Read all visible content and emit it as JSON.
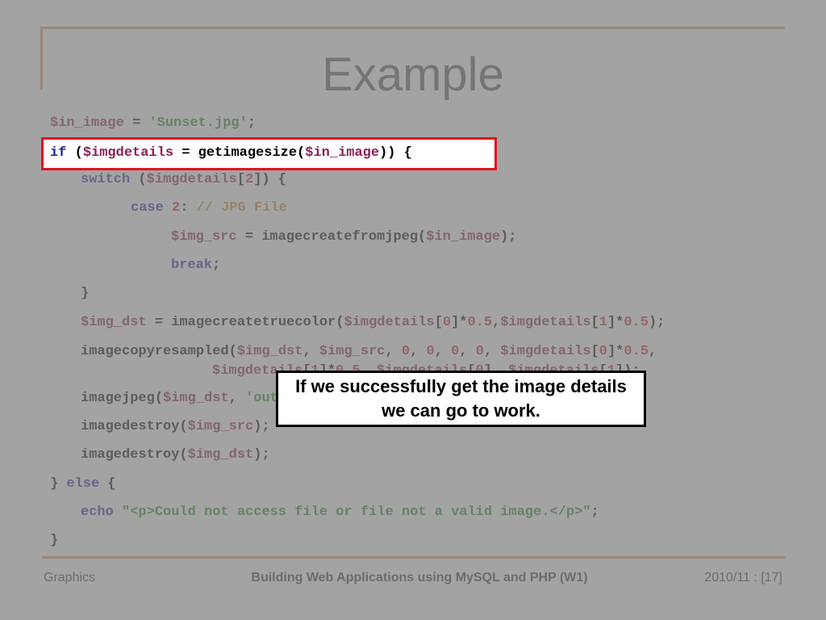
{
  "slide": {
    "title": "Example",
    "callout_text": "If we successfully get the image details we can go to work."
  },
  "code": {
    "l1": {
      "v1": "$in_image",
      "op": " = ",
      "s1": "'Sunset.jpg'",
      "end": ";"
    },
    "l2": {
      "k1": "if",
      "p1": " (",
      "v1": "$imgdetails",
      "p2": " = getimagesize(",
      "v2": "$in_image",
      "p3": ")) {"
    },
    "l3": {
      "k1": "switch",
      "p1": " (",
      "v1": "$imgdetails",
      "p2": "[",
      "n1": "2",
      "p3": "]) {"
    },
    "l4": {
      "k1": "case",
      "p1": " ",
      "n1": "2",
      "p2": ": ",
      "c1": "// JPG File"
    },
    "l5": {
      "v1": "$img_src",
      "p1": " = imagecreatefromjpeg(",
      "v2": "$in_image",
      "p2": ");"
    },
    "l6": {
      "k1": "break",
      "p1": ";"
    },
    "l7": {
      "p1": "}"
    },
    "l8": {
      "v1": "$img_dst",
      "p1": " = imagecreatetruecolor(",
      "v2": "$imgdetails",
      "p2": "[",
      "n1": "0",
      "p3": "]*",
      "n2": "0.5",
      "p4": ",",
      "v3": "$imgdetails",
      "p5": "[",
      "n3": "1",
      "p6": "]*",
      "n4": "0.5",
      "p7": ");"
    },
    "l9": {
      "p1": "imagecopyresampled(",
      "v1": "$img_dst",
      "p2": ", ",
      "v2": "$img_src",
      "p3": ", ",
      "n1": "0",
      "p4": ", ",
      "n2": "0",
      "p5": ", ",
      "n3": "0",
      "p6": ", ",
      "n4": "0",
      "p7": ", ",
      "v3": "$imgdetails",
      "p8": "[",
      "n5": "0",
      "p9": "]*",
      "n6": "0.5",
      "p10": ","
    },
    "l10": {
      "v1": "$imgdetails",
      "p1": "[",
      "n1": "1",
      "p2": "]*",
      "n2": "0.5",
      "p3": ", ",
      "v2": "$imgdetails",
      "p4": "[",
      "n3": "0",
      "p5": "], ",
      "v3": "$imgdetails",
      "p6": "[",
      "n4": "1",
      "p7": "]);"
    },
    "l11": {
      "p1": "imagejpeg(",
      "v1": "$img_dst",
      "p2": ", ",
      "s1": "'output.jpg"
    },
    "l12": {
      "p1": "imagedestroy(",
      "v1": "$img_src",
      "p2": ");"
    },
    "l13": {
      "p1": "imagedestroy(",
      "v1": "$img_dst",
      "p2": ");"
    },
    "l14": {
      "p1": "} ",
      "k1": "else",
      "p2": " {"
    },
    "l15": {
      "k1": "echo",
      "p1": " ",
      "s1": "\"<p>Could not access file or file not a valid image.</p>\"",
      "p2": ";"
    },
    "l16": {
      "p1": "}"
    }
  },
  "footer": {
    "left": "Graphics",
    "center": "Building Web Applications using MySQL and PHP (W1)",
    "right": "2010/11 : [17]"
  },
  "colors": {
    "frame": "#d6a352",
    "highlight_border": "#e0141e",
    "variable": "#8b2252",
    "keyword": "#2222aa",
    "string": "#228b22",
    "number": "#cc2222",
    "comment": "#d08a2a"
  }
}
